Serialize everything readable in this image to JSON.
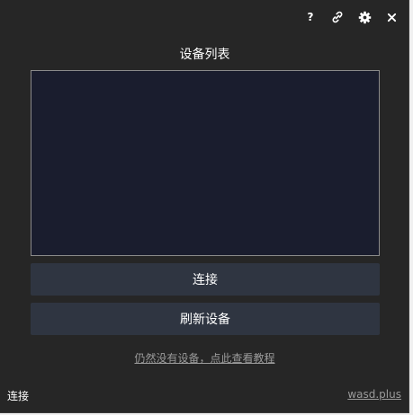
{
  "header": {
    "icons": [
      "help-icon",
      "link-icon",
      "gear-icon",
      "close-icon"
    ],
    "help_glyph": "?"
  },
  "main": {
    "title": "设备列表",
    "connect_label": "连接",
    "refresh_label": "刷新设备",
    "tutorial_link": "仍然没有设备，点此查看教程"
  },
  "footer": {
    "status": "连接",
    "site": "wasd.plus"
  },
  "colors": {
    "window_bg": "#262626",
    "list_bg": "#1a1d2e",
    "button_bg": "#2f3541",
    "link_color": "#9a9a9a"
  }
}
